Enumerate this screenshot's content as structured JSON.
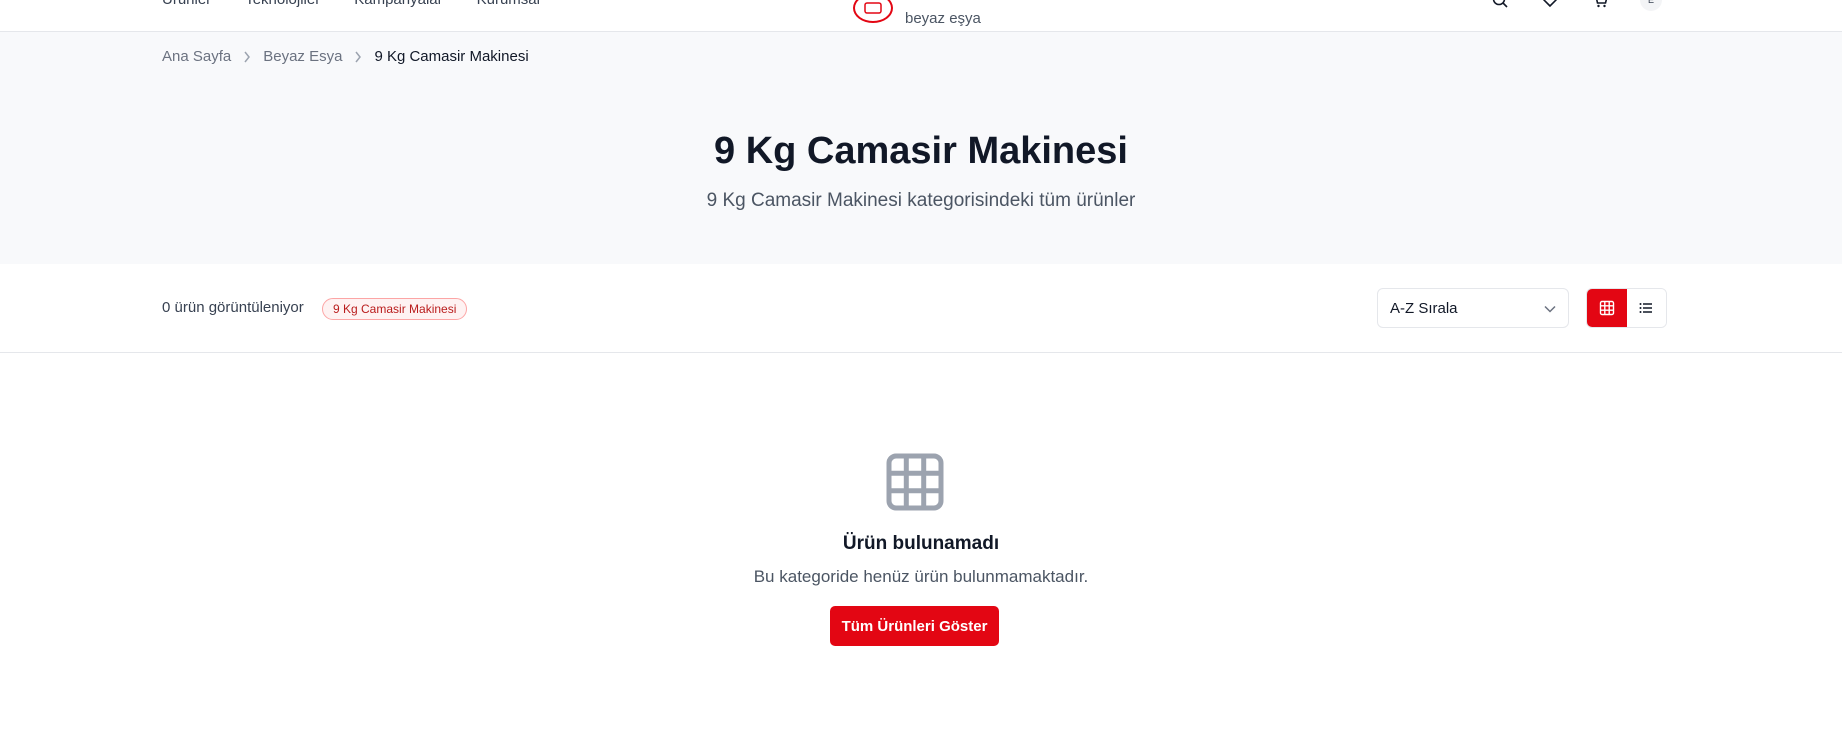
{
  "nav": {
    "links": [
      "Ürünler",
      "Teknolojiler",
      "Kampanyalar",
      "Kurumsal"
    ],
    "brand_tagline": "beyaz eşya",
    "avatar_initial": "E"
  },
  "breadcrumb": [
    "Ana Sayfa",
    "Beyaz Esya",
    "9 Kg Camasir Makinesi"
  ],
  "hero": {
    "title": "9 Kg Camasir Makinesi",
    "subtitle": "9 Kg Camasir Makinesi kategorisindeki tüm ürünler"
  },
  "toolbar": {
    "count_text": "0 ürün görüntüleniyor",
    "filter_chip": "9 Kg Camasir Makinesi",
    "sort_value": "A-Z Sırala",
    "view_mode": "grid"
  },
  "empty_state": {
    "icon": "grid-icon",
    "title": "Ürün bulunamadı",
    "description": "Bu kategoride henüz ürün bulunmamaktadır.",
    "button_label": "Tüm Ürünleri Göster"
  },
  "colors": {
    "accent": "#e30613",
    "hero_bg": "#f8f9fb"
  }
}
